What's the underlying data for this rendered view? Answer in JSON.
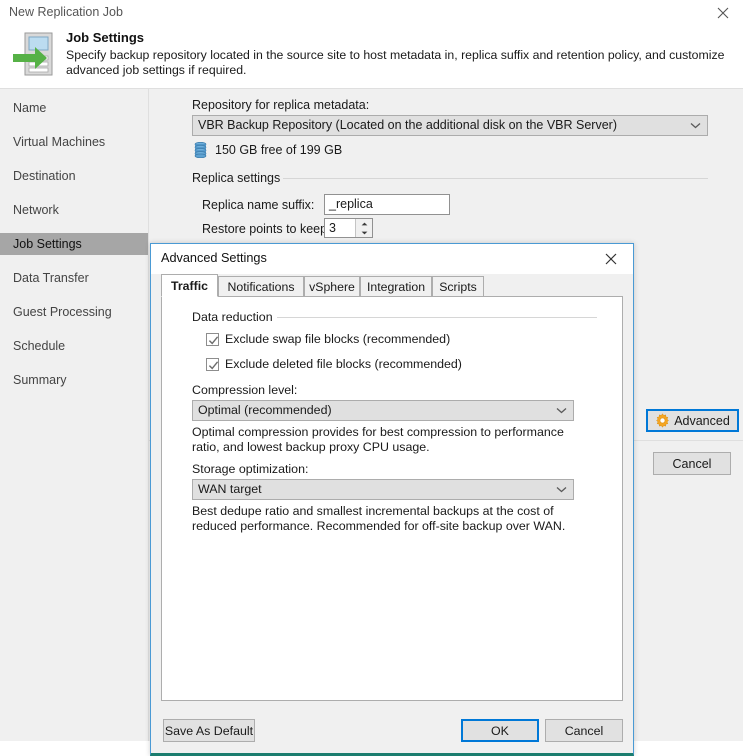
{
  "wizard": {
    "window_title": "New Replication Job",
    "close_icon": "close-icon",
    "header": {
      "title": "Job Settings",
      "description": "Specify backup repository located in the source site to host metadata in, replica suffix and retention policy, and customize advanced job settings if required.",
      "icon": "replication-job-icon"
    },
    "sidebar": {
      "items": [
        {
          "label": "Name",
          "selected": false
        },
        {
          "label": "Virtual Machines",
          "selected": false
        },
        {
          "label": "Destination",
          "selected": false
        },
        {
          "label": "Network",
          "selected": false
        },
        {
          "label": "Job Settings",
          "selected": true
        },
        {
          "label": "Data Transfer",
          "selected": false
        },
        {
          "label": "Guest Processing",
          "selected": false
        },
        {
          "label": "Schedule",
          "selected": false
        },
        {
          "label": "Summary",
          "selected": false
        }
      ]
    },
    "main": {
      "repository_label": "Repository for replica metadata:",
      "repository_value": "VBR Backup Repository (Located on the additional disk on the VBR Server)",
      "repository_free_space": "150 GB free of 199 GB",
      "disk_icon": "disk-stack-icon",
      "replica_group_label": "Replica settings",
      "replica_suffix_label": "Replica name suffix:",
      "replica_suffix_value": "_replica",
      "restore_points_label": "Restore points to keep:",
      "restore_points_value": "3"
    },
    "buttons": {
      "advanced_label": "Advanced",
      "advanced_icon": "gear-icon",
      "cancel_label": "Cancel"
    }
  },
  "dialog": {
    "title": "Advanced Settings",
    "close_icon": "close-icon",
    "tabs": [
      {
        "label": "Traffic",
        "active": true
      },
      {
        "label": "Notifications",
        "active": false
      },
      {
        "label": "vSphere",
        "active": false
      },
      {
        "label": "Integration",
        "active": false
      },
      {
        "label": "Scripts",
        "active": false
      }
    ],
    "traffic": {
      "group_label": "Data reduction",
      "checkboxes": [
        {
          "label": "Exclude swap file blocks (recommended)",
          "checked": true
        },
        {
          "label": "Exclude deleted file blocks (recommended)",
          "checked": true
        }
      ],
      "compression_label": "Compression level:",
      "compression_value": "Optimal (recommended)",
      "compression_desc": "Optimal compression provides for best compression to performance ratio, and lowest backup proxy CPU usage.",
      "storage_label": "Storage optimization:",
      "storage_value": "WAN target",
      "storage_desc": "Best dedupe ratio and smallest incremental backups at the cost of reduced performance. Recommended for off-site backup over WAN."
    },
    "buttons": {
      "save_as_default_label": "Save As Default",
      "ok_label": "OK",
      "cancel_label": "Cancel"
    }
  },
  "colors": {
    "accent": "#0078d7",
    "dialog_border": "#4a9ad4",
    "dialog_bottom_border": "#1b7d6e",
    "selected_nav": "#a6a6a6",
    "panel_bg": "#f0f0f0",
    "gear_orange": "#f5a623",
    "disk_blue": "#4a90c4",
    "arrow_green": "#56b146"
  }
}
